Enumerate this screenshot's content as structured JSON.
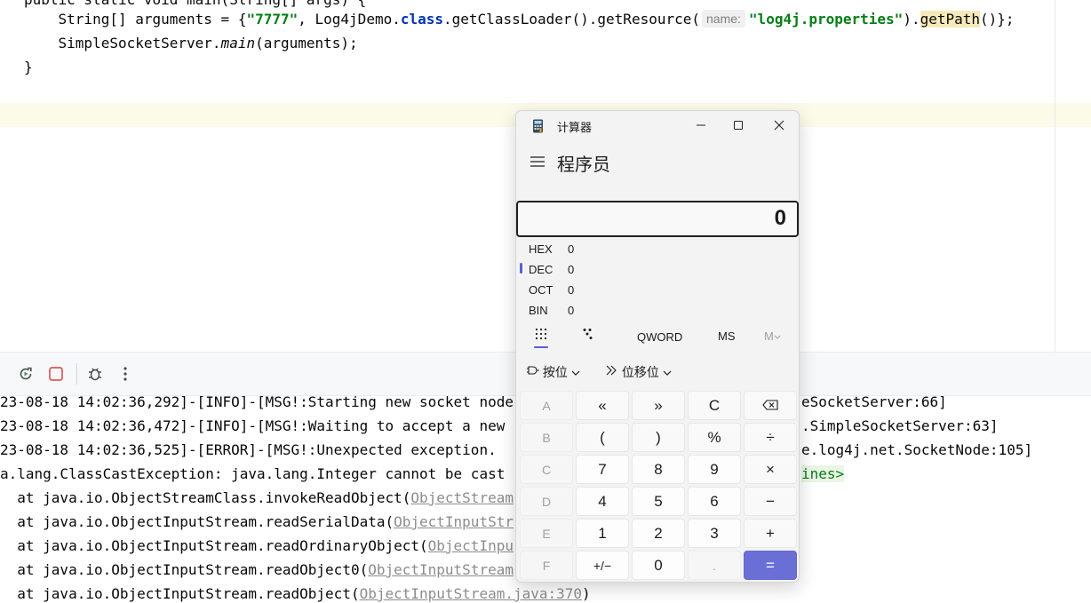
{
  "editor": {
    "line0": "public static void main(String[] args) {",
    "line1": {
      "indent": "    ",
      "type_part": "String[] arguments = {",
      "str1": "\"7777\"",
      "mid": ", Log4jDemo.",
      "kw_class": "class",
      "call": ".getClassLoader().getResource(",
      "hint": "name:",
      "str2": "\"log4j.properties\"",
      "close": ").",
      "getpath": "getPath",
      "end": "()};"
    },
    "line2": {
      "indent": "    ",
      "pre": "SimpleSocketServer.",
      "method": "main",
      "post": "(arguments);"
    },
    "line3": "}"
  },
  "console": {
    "lines": [
      {
        "text": "23-08-18 14:02:36,292]-[INFO]-[MSG!:Starting new socket node",
        "tail": "eSocketServer:66]"
      },
      {
        "text": "23-08-18 14:02:36,472]-[INFO]-[MSG!:Waiting to accept a new",
        "tail": ".SimpleSocketServer:63]"
      },
      {
        "text": "23-08-18 14:02:36,525]-[ERROR]-[MSG!:Unexpected exception.",
        "tail": "e.log4j.net.SocketNode:105]"
      },
      {
        "text": "a.lang.ClassCastException: java.lang.Integer cannot be cast",
        "tail": "ines>"
      },
      {
        "pre": "  at java.io.ObjectStreamClass.invokeReadObject(",
        "link": "ObjectStream"
      },
      {
        "pre": "  at java.io.ObjectInputStream.readSerialData(",
        "link": "ObjectInputStr"
      },
      {
        "pre": "  at java.io.ObjectInputStream.readOrdinaryObject(",
        "link": "ObjectInpu"
      },
      {
        "pre": "  at java.io.ObjectInputStream.readObject0(",
        "link": "ObjectInputStream"
      },
      {
        "pre": "  at java.io.ObjectInputStream.readObject(",
        "link": "ObjectInputStream.java:370",
        "post": ")"
      }
    ]
  },
  "calculator": {
    "title": "计算器",
    "mode": "程序员",
    "display": "0",
    "bases": [
      {
        "label": "HEX",
        "value": "0"
      },
      {
        "label": "DEC",
        "value": "0"
      },
      {
        "label": "OCT",
        "value": "0"
      },
      {
        "label": "BIN",
        "value": "0"
      }
    ],
    "word_size": "QWORD",
    "memory_store": "MS",
    "memory_menu": "M",
    "bitwise": "按位",
    "bitshift": "位移位",
    "keys": {
      "A": "A",
      "lshift": "«",
      "rshift": "»",
      "clear": "C",
      "B": "B",
      "lparen": "(",
      "rparen": ")",
      "percent": "%",
      "divide": "÷",
      "C": "C",
      "seven": "7",
      "eight": "8",
      "nine": "9",
      "multiply": "×",
      "D": "D",
      "four": "4",
      "five": "5",
      "six": "6",
      "minus": "−",
      "E": "E",
      "one": "1",
      "two": "2",
      "three": "3",
      "plus": "+",
      "F": "F",
      "negate": "+/−",
      "zero": "0",
      "decimal": ".",
      "equals": "="
    }
  }
}
